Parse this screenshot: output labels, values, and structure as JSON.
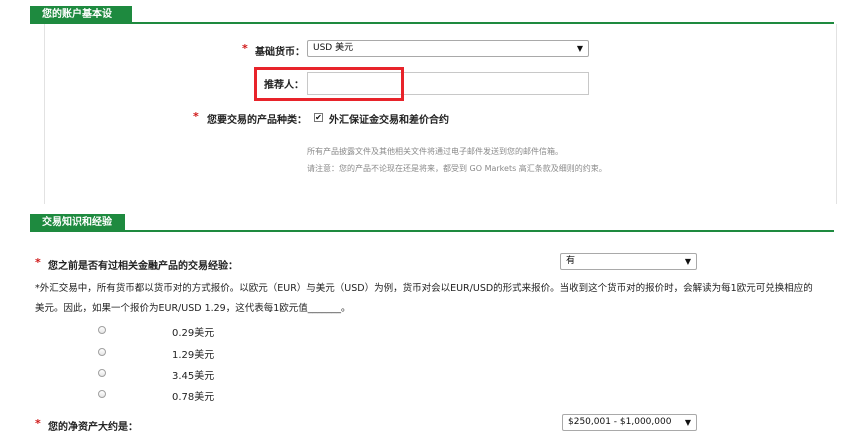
{
  "account_section": {
    "tab_label": "您的账户基本设置",
    "currency": {
      "required_mark": "*",
      "label": "基础货币：",
      "value": "USD 美元"
    },
    "referrer": {
      "label": "推荐人：",
      "value": ""
    },
    "product_types": {
      "required_mark": "*",
      "label": "您要交易的产品种类：",
      "option_label": "外汇保证金交易和差价合约",
      "checked": true
    },
    "notes": [
      "所有产品披露文件及其他相关文件将通过电子邮件发送到您的邮件信箱。",
      "请注意：您的产品不论现在还是将来，都受到 GO Markets 高汇条款及细则的约束。"
    ]
  },
  "knowledge_section": {
    "tab_label": "交易知识和经验",
    "experience": {
      "required_mark": "*",
      "label": "您之前是否有过相关金融产品的交易经验：",
      "value": "有"
    },
    "question_line1": "*外汇交易中，所有货币都以货币对的方式报价。以欧元（EUR）与美元（USD）为例，货币对会以EUR/USD的形式来报价。当收到这个货币对的报价时，会解读为每1欧元可兑换相应的",
    "question_line2": "美元。因此，如果一个报价为EUR/USD 1.29，这代表每1欧元值_______。",
    "answers": [
      "0.29美元",
      "1.29美元",
      "3.45美元",
      "0.78美元"
    ],
    "net_assets": {
      "required_mark": "*",
      "label": "您的净资产大约是：",
      "value": "$250,001 - $1,000,000"
    }
  },
  "icons": {
    "caret": "▼",
    "check": "✔"
  }
}
